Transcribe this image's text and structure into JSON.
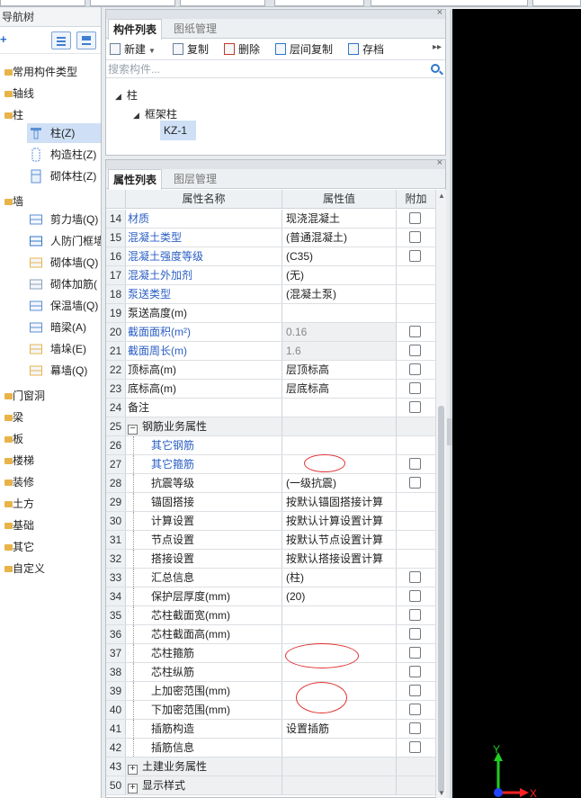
{
  "nav": {
    "title": "导航树",
    "add_symbol": "+",
    "groups": [
      {
        "label": "常用构件类型"
      },
      {
        "label": "轴线"
      },
      {
        "label": "柱"
      },
      {
        "label": "墙"
      },
      {
        "label": "门窗洞"
      },
      {
        "label": "梁"
      },
      {
        "label": "板"
      },
      {
        "label": "楼梯"
      },
      {
        "label": "装修"
      },
      {
        "label": "土方"
      },
      {
        "label": "基础"
      },
      {
        "label": "其它"
      },
      {
        "label": "自定义"
      }
    ],
    "column_children": [
      "柱(Z)",
      "构造柱(Z)",
      "砌体柱(Z)"
    ],
    "wall_children": [
      "剪力墙(Q)",
      "人防门框墙",
      "砌体墙(Q)",
      "砌体加筋(",
      "保温墙(Q)",
      "暗梁(A)",
      "墙垛(E)",
      "幕墙(Q)"
    ]
  },
  "component_panel": {
    "tabs": [
      "构件列表",
      "图纸管理"
    ],
    "toolbar": {
      "new": "新建",
      "copy": "复制",
      "delete": "删除",
      "floor_copy": "层间复制",
      "archive": "存档"
    },
    "search_placeholder": "搜索构件...",
    "tree": {
      "root": "柱",
      "child": "框架柱",
      "selected": "KZ-1"
    }
  },
  "property_panel": {
    "tabs": [
      "属性列表",
      "图层管理"
    ],
    "headers": {
      "name": "属性名称",
      "value": "属性值",
      "add": "附加"
    },
    "rows": [
      {
        "num": "14",
        "name": "材质",
        "value": "现浇混凝土",
        "blue": true,
        "check": true
      },
      {
        "num": "15",
        "name": "混凝土类型",
        "value": "(普通混凝土)",
        "blue": true,
        "check": true
      },
      {
        "num": "16",
        "name": "混凝土强度等级",
        "value": "(C35)",
        "blue": true,
        "check": true
      },
      {
        "num": "17",
        "name": "混凝土外加剂",
        "value": "(无)",
        "blue": true,
        "check": false
      },
      {
        "num": "18",
        "name": "泵送类型",
        "value": "(混凝土泵)",
        "blue": true,
        "check": false
      },
      {
        "num": "19",
        "name": "泵送高度(m)",
        "value": "",
        "blue": false,
        "check": false
      },
      {
        "num": "20",
        "name": "截面面积(m²)",
        "value": "0.16",
        "blue": true,
        "check": true,
        "gray": true
      },
      {
        "num": "21",
        "name": "截面周长(m)",
        "value": "1.6",
        "blue": true,
        "check": true,
        "gray": true
      },
      {
        "num": "22",
        "name": "顶标高(m)",
        "value": "层顶标高",
        "blue": false,
        "check": true
      },
      {
        "num": "23",
        "name": "底标高(m)",
        "value": "层底标高",
        "blue": false,
        "check": true
      },
      {
        "num": "24",
        "name": "备注",
        "value": "",
        "blue": false,
        "check": true
      },
      {
        "num": "25",
        "name": "钢筋业务属性",
        "value": "",
        "group": "−",
        "shade": true
      },
      {
        "num": "26",
        "name": "其它钢筋",
        "value": "",
        "blue": true,
        "indent": true
      },
      {
        "num": "27",
        "name": "其它箍筋",
        "value": "",
        "blue": true,
        "indent": true,
        "check": true
      },
      {
        "num": "28",
        "name": "抗震等级",
        "value": "(一级抗震)",
        "indent": true,
        "check": true
      },
      {
        "num": "29",
        "name": "锚固搭接",
        "value": "按默认锚固搭接计算",
        "indent": true
      },
      {
        "num": "30",
        "name": "计算设置",
        "value": "按默认计算设置计算",
        "indent": true
      },
      {
        "num": "31",
        "name": "节点设置",
        "value": "按默认节点设置计算",
        "indent": true
      },
      {
        "num": "32",
        "name": "搭接设置",
        "value": "按默认搭接设置计算",
        "indent": true
      },
      {
        "num": "33",
        "name": "汇总信息",
        "value": "(柱)",
        "indent": true,
        "check": true
      },
      {
        "num": "34",
        "name": "保护层厚度(mm)",
        "value": "(20)",
        "indent": true,
        "check": true
      },
      {
        "num": "35",
        "name": "芯柱截面宽(mm)",
        "value": "",
        "indent": true,
        "check": true
      },
      {
        "num": "36",
        "name": "芯柱截面高(mm)",
        "value": "",
        "indent": true,
        "check": true
      },
      {
        "num": "37",
        "name": "芯柱箍筋",
        "value": "",
        "indent": true,
        "check": true
      },
      {
        "num": "38",
        "name": "芯柱纵筋",
        "value": "",
        "indent": true,
        "check": true
      },
      {
        "num": "39",
        "name": "上加密范围(mm)",
        "value": "",
        "indent": true,
        "check": true
      },
      {
        "num": "40",
        "name": "下加密范围(mm)",
        "value": "",
        "indent": true,
        "check": true
      },
      {
        "num": "41",
        "name": "插筋构造",
        "value": "设置插筋",
        "indent": true,
        "check": true
      },
      {
        "num": "42",
        "name": "插筋信息",
        "value": "",
        "indent": true,
        "check": true
      },
      {
        "num": "43",
        "name": "土建业务属性",
        "value": "",
        "group": "+",
        "shade": true
      },
      {
        "num": "50",
        "name": "显示样式",
        "value": "",
        "group": "+",
        "shade": true
      }
    ]
  },
  "viewport": {
    "axis_y": "Y",
    "axis_x": "X",
    "colors": {
      "y": "#22cc22",
      "x": "#ff2222",
      "origin": "#2244ff"
    }
  }
}
